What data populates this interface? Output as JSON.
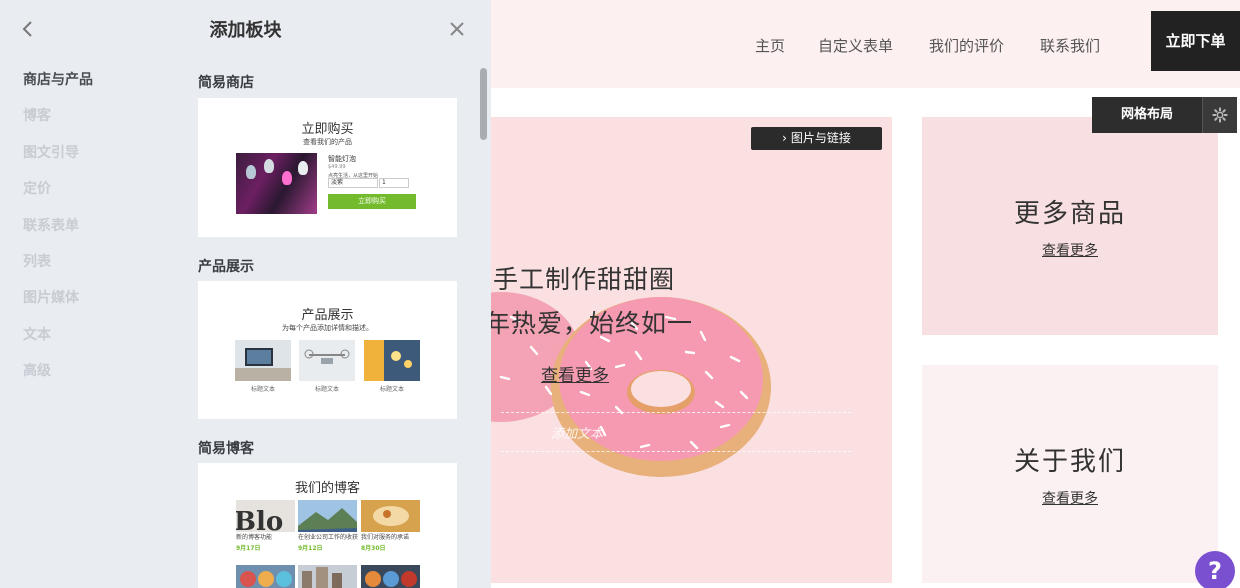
{
  "panel": {
    "title": "添加板块",
    "categories": [
      {
        "label": "商店与产品",
        "active": true
      },
      {
        "label": "博客"
      },
      {
        "label": "图文引导"
      },
      {
        "label": "定价"
      },
      {
        "label": "联系表单"
      },
      {
        "label": "列表"
      },
      {
        "label": "图片媒体"
      },
      {
        "label": "文本"
      },
      {
        "label": "高级"
      }
    ],
    "sections": [
      {
        "heading": "简易商店",
        "card": {
          "title": "立即购买",
          "subtitle": "查看我们的产品",
          "product_name": "智能灯泡",
          "price": "$49.99",
          "desc": "点亮生活，从这里开始",
          "select_value": "淡紫",
          "qty_value": "1",
          "buy_label": "立即购买"
        }
      },
      {
        "heading": "产品展示",
        "card": {
          "title": "产品展示",
          "subtitle": "为每个产品添加详情和描述。",
          "items": [
            {
              "caption": "标题文本"
            },
            {
              "caption": "标题文本"
            },
            {
              "caption": "标题文本"
            }
          ]
        }
      },
      {
        "heading": "简易博客",
        "card": {
          "title": "我们的博客",
          "posts": [
            {
              "caption": "新的博客功能",
              "date": "9月17日"
            },
            {
              "caption": "在创业公司工作的收获",
              "date": "9月12日"
            },
            {
              "caption": "我们对服务的承诺",
              "date": "8月30日"
            }
          ]
        }
      }
    ]
  },
  "site": {
    "nav": [
      "主页",
      "自定义表单",
      "我们的评价",
      "联系我们"
    ],
    "order_button": "立即下单",
    "grid_button": "网格布局",
    "hero": {
      "image_link_button": "图片与链接",
      "line1": "手工制作甜甜圈",
      "line2": "年热爱，始终如一",
      "more": "查看更多",
      "add_text_placeholder": "添加文本"
    },
    "tiles": [
      {
        "title": "更多商品",
        "more": "查看更多"
      },
      {
        "title": "关于我们",
        "more": "查看更多"
      }
    ],
    "help_label": "?"
  },
  "colors": {
    "panel_bg": "#e9ecf1",
    "accent_green": "#73bb2c",
    "hero_bg": "#fbe0e2",
    "help_purple": "#7a4fd0",
    "dark_button": "#222222"
  },
  "icons": [
    "chevron-left-icon",
    "close-icon",
    "chevron-right-icon",
    "gear-icon",
    "question-icon"
  ]
}
